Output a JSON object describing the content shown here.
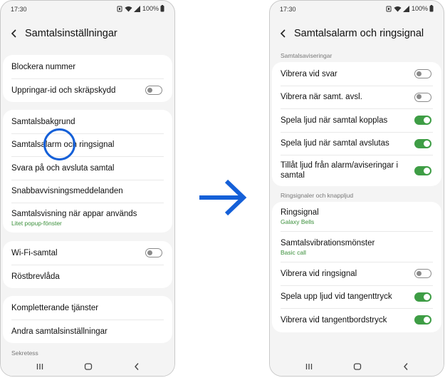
{
  "colors": {
    "accent_green": "#3e9d45",
    "arrow_blue": "#1560d8",
    "highlight_blue": "#1560d8"
  },
  "left": {
    "status": {
      "time": "17:30",
      "battery": "100%"
    },
    "title": "Samtalsinställningar",
    "group1": [
      {
        "label": "Blockera nummer"
      },
      {
        "label": "Uppringar-id och skräpskydd",
        "toggle": "off"
      }
    ],
    "group2": [
      {
        "label": "Samtalsbakgrund"
      },
      {
        "label": "Samtalsalarm och ringsignal"
      },
      {
        "label": "Svara på och avsluta samtal"
      },
      {
        "label": "Snabbavvisningsmeddelanden"
      },
      {
        "label": "Samtalsvisning när appar används",
        "sub": "Litet popup-fönster"
      }
    ],
    "group3": [
      {
        "label": "Wi-Fi-samtal",
        "toggle": "off"
      },
      {
        "label": "Röstbrevlåda"
      }
    ],
    "group4": [
      {
        "label": "Kompletterande tjänster"
      },
      {
        "label": "Andra samtalsinställningar"
      }
    ],
    "section_privacy": "Sekretess"
  },
  "right": {
    "status": {
      "time": "17:30",
      "battery": "100%"
    },
    "title": "Samtalsalarm och ringsignal",
    "section1": "Samtalsaviseringar",
    "group1": [
      {
        "label": "Vibrera vid svar",
        "toggle": "off"
      },
      {
        "label": "Vibrera när samt. avsl.",
        "toggle": "off"
      },
      {
        "label": "Spela ljud när samtal kopplas",
        "toggle": "on"
      },
      {
        "label": "Spela ljud när samtal avslutas",
        "toggle": "on"
      },
      {
        "label": "Tillåt ljud från alarm/aviseringar i samtal",
        "toggle": "on"
      }
    ],
    "section2": "Ringsignaler och knappljud",
    "group2": [
      {
        "label": "Ringsignal",
        "sub": "Galaxy Bells"
      },
      {
        "label": "Samtalsvibrationsmönster",
        "sub": "Basic call"
      },
      {
        "label": "Vibrera vid ringsignal",
        "toggle": "off"
      },
      {
        "label": "Spela upp ljud vid tangenttryck",
        "toggle": "on"
      },
      {
        "label": "Vibrera vid tangentbordstryck",
        "toggle": "on"
      }
    ]
  }
}
